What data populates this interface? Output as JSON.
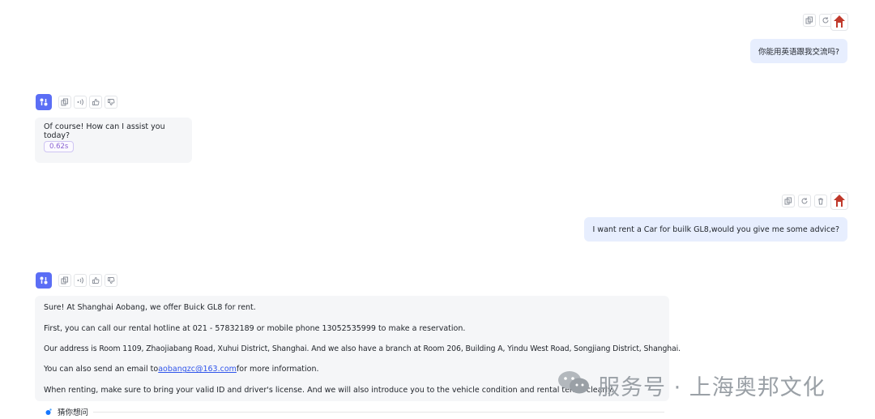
{
  "messages": {
    "user1": {
      "text": "你能用英语跟我交流吗?"
    },
    "bot1": {
      "text": "Of course! How can I assist you today?",
      "time": "0.62s"
    },
    "user2": {
      "text": "I want rent a Car for builk GL8,would you give me some advice?"
    },
    "bot2": {
      "lines": {
        "l1": "Sure! At Shanghai Aobang, we offer Buick GL8 for rent.",
        "l2": "First, you can call our rental hotline at 021 - 57832189 or mobile phone 13052535999 to make a reservation.",
        "l3": "Our address is Room 1109, Zhaojiabang Road, Xuhui District, Shanghai. And we also have a branch at Room 206, Building A, Yindu West Road, Songjiang District, Shanghai.",
        "l4_pre": "You can also send an email to ",
        "l4_email": "aobangzc@163.com",
        "l4_post": " for more information.",
        "l5": "When renting, make sure to bring your valid ID and driver's license. And we will also introduce you to the vehicle condition and rental terms clearly."
      }
    }
  },
  "guess": {
    "label": "猜你想问"
  },
  "watermark": {
    "text": "服务号 · 上海奥邦文化"
  },
  "icons": {
    "user_tools": [
      "copy-icon",
      "refresh-icon",
      "delete-icon"
    ],
    "bot_tools": [
      "copy-icon",
      "speaker-icon",
      "thumbs-up-icon",
      "thumbs-down-icon"
    ]
  },
  "colors": {
    "user_bubble": "#e7eefe",
    "bot_bubble": "#f5f6f8",
    "bot_logo": "#5b6ef5",
    "badge": "#8a63d2"
  }
}
